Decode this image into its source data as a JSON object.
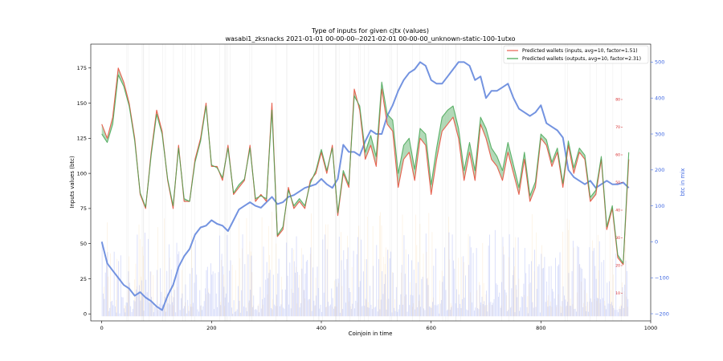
{
  "chart_data": {
    "type": "line",
    "title": "Type of inputs for given cjtx (values)",
    "subtitle": "wasabi1_zksnacks 2021-01-01 00-00-00--2021-02-01 00-00-00_unknown-static-100-1utxo",
    "xlabel": "Coinjoin in time",
    "ylabel": "Inputs values (btc)",
    "y2label": "btc in mix",
    "xlim": [
      -20,
      1000
    ],
    "ylim": [
      -5,
      192
    ],
    "y2lim": [
      -220,
      550
    ],
    "y3lim": [
      0,
      100
    ],
    "x_ticks": [
      0,
      200,
      400,
      600,
      800,
      1000
    ],
    "y_ticks": [
      0,
      25,
      50,
      75,
      100,
      125,
      150,
      175
    ],
    "y2_ticks": [
      -200,
      -100,
      0,
      100,
      200,
      300,
      400,
      500
    ],
    "y3_ticks": [
      10,
      20,
      30,
      40,
      50,
      60,
      70,
      80
    ],
    "legend_position": "top-right",
    "colors": {
      "inputs": "#e8614f",
      "outputs": "#3fa34d",
      "btc": "#7393e0",
      "fill": "#3fa34d",
      "bars_blue": "#8c9cf0",
      "bars_orange": "#f5c88a"
    },
    "series": [
      {
        "name": "Predicted wallets (inputs, avg=10, factor=1.51)",
        "x": [
          0,
          10,
          20,
          30,
          40,
          50,
          60,
          70,
          80,
          90,
          100,
          110,
          120,
          130,
          140,
          150,
          160,
          170,
          180,
          190,
          200,
          210,
          220,
          230,
          240,
          250,
          260,
          270,
          280,
          290,
          300,
          310,
          320,
          330,
          340,
          350,
          360,
          370,
          380,
          390,
          400,
          410,
          420,
          430,
          440,
          450,
          460,
          470,
          480,
          490,
          500,
          510,
          520,
          530,
          540,
          550,
          560,
          570,
          580,
          590,
          600,
          610,
          620,
          630,
          640,
          650,
          660,
          670,
          680,
          690,
          700,
          710,
          720,
          730,
          740,
          750,
          760,
          770,
          780,
          790,
          800,
          810,
          820,
          830,
          840,
          850,
          860,
          870,
          880,
          890,
          900,
          910,
          920,
          930,
          940,
          950,
          960
        ],
        "y": [
          135,
          125,
          140,
          175,
          165,
          150,
          125,
          85,
          75,
          115,
          145,
          130,
          95,
          75,
          120,
          80,
          80,
          110,
          125,
          150,
          105,
          105,
          95,
          120,
          85,
          90,
          95,
          120,
          80,
          85,
          80,
          150,
          55,
          60,
          90,
          75,
          80,
          75,
          95,
          100,
          115,
          100,
          120,
          70,
          100,
          90,
          160,
          145,
          110,
          120,
          105,
          160,
          135,
          130,
          90,
          110,
          115,
          95,
          125,
          120,
          85,
          110,
          130,
          135,
          140,
          125,
          95,
          115,
          95,
          135,
          125,
          110,
          105,
          95,
          115,
          100,
          85,
          110,
          80,
          90,
          125,
          120,
          105,
          115,
          90,
          120,
          100,
          115,
          110,
          80,
          85,
          110,
          60,
          75,
          40,
          35,
          110
        ]
      },
      {
        "name": "Predicted wallets (outputs, avg=10, factor=2.31)",
        "x": [
          0,
          10,
          20,
          30,
          40,
          50,
          60,
          70,
          80,
          90,
          100,
          110,
          120,
          130,
          140,
          150,
          160,
          170,
          180,
          190,
          200,
          210,
          220,
          230,
          240,
          250,
          260,
          270,
          280,
          290,
          300,
          310,
          320,
          330,
          340,
          350,
          360,
          370,
          380,
          390,
          400,
          410,
          420,
          430,
          440,
          450,
          460,
          470,
          480,
          490,
          500,
          510,
          520,
          530,
          540,
          550,
          560,
          570,
          580,
          590,
          600,
          610,
          620,
          630,
          640,
          650,
          660,
          670,
          680,
          690,
          700,
          710,
          720,
          730,
          740,
          750,
          760,
          770,
          780,
          790,
          800,
          810,
          820,
          830,
          840,
          850,
          860,
          870,
          880,
          890,
          900,
          910,
          920,
          930,
          940,
          950,
          960
        ],
        "y": [
          128,
          122,
          135,
          170,
          162,
          148,
          123,
          86,
          76,
          113,
          142,
          128,
          96,
          77,
          118,
          82,
          80,
          108,
          123,
          148,
          106,
          104,
          97,
          118,
          86,
          92,
          96,
          118,
          82,
          84,
          82,
          145,
          56,
          62,
          88,
          77,
          82,
          77,
          93,
          102,
          117,
          102,
          118,
          72,
          102,
          92,
          155,
          148,
          115,
          127,
          112,
          165,
          142,
          138,
          100,
          120,
          125,
          103,
          132,
          128,
          92,
          118,
          140,
          145,
          148,
          132,
          102,
          122,
          102,
          140,
          132,
          118,
          112,
          102,
          122,
          106,
          90,
          115,
          84,
          94,
          128,
          124,
          108,
          118,
          93,
          123,
          104,
          118,
          113,
          83,
          88,
          112,
          62,
          77,
          42,
          36,
          115
        ]
      },
      {
        "name": "btc in mix",
        "axis": "right",
        "x": [
          0,
          10,
          20,
          30,
          40,
          50,
          60,
          70,
          80,
          90,
          100,
          110,
          120,
          130,
          140,
          150,
          160,
          170,
          180,
          190,
          200,
          210,
          220,
          230,
          240,
          250,
          260,
          270,
          280,
          290,
          300,
          310,
          320,
          330,
          340,
          350,
          360,
          370,
          380,
          390,
          400,
          410,
          420,
          430,
          440,
          450,
          460,
          470,
          480,
          490,
          500,
          510,
          520,
          530,
          540,
          550,
          560,
          570,
          580,
          590,
          600,
          610,
          620,
          630,
          640,
          650,
          660,
          670,
          680,
          690,
          700,
          710,
          720,
          730,
          740,
          750,
          760,
          770,
          780,
          790,
          800,
          810,
          820,
          830,
          840,
          850,
          860,
          870,
          880,
          890,
          900,
          910,
          920,
          930,
          940,
          950,
          960
        ],
        "y": [
          0,
          -60,
          -80,
          -100,
          -120,
          -130,
          -150,
          -140,
          -155,
          -165,
          -180,
          -190,
          -150,
          -120,
          -70,
          -40,
          -20,
          20,
          40,
          45,
          60,
          50,
          45,
          30,
          60,
          90,
          100,
          110,
          100,
          95,
          110,
          125,
          105,
          110,
          125,
          130,
          140,
          150,
          155,
          160,
          175,
          160,
          150,
          175,
          270,
          250,
          250,
          240,
          280,
          310,
          300,
          300,
          350,
          380,
          420,
          450,
          470,
          480,
          500,
          490,
          450,
          440,
          440,
          460,
          480,
          500,
          500,
          490,
          450,
          460,
          400,
          420,
          420,
          430,
          440,
          400,
          370,
          360,
          350,
          360,
          380,
          330,
          320,
          310,
          290,
          200,
          180,
          170,
          160,
          170,
          150,
          160,
          170,
          160,
          160,
          165,
          150
        ]
      }
    ]
  }
}
